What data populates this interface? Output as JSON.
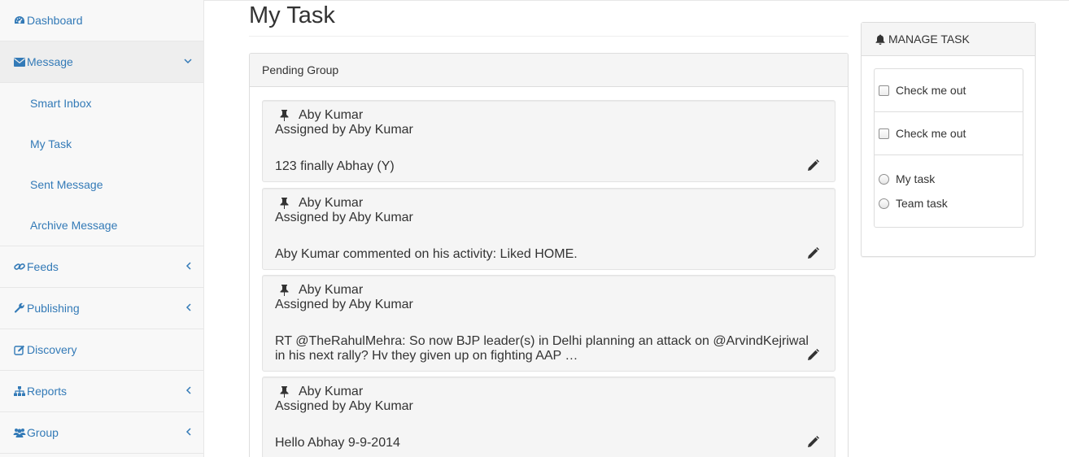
{
  "sidebar": {
    "dashboard": {
      "label": "Dashboard",
      "icon": "dashboard-icon"
    },
    "message": {
      "label": "Message",
      "icon": "envelope-icon"
    },
    "message_sub": [
      "Smart Inbox",
      "My Task",
      "Sent Message",
      "Archive Message"
    ],
    "feeds": {
      "label": "Feeds",
      "icon": "link-icon"
    },
    "publishing": {
      "label": "Publishing",
      "icon": "wrench-icon"
    },
    "discovery": {
      "label": "Discovery",
      "icon": "edit-icon"
    },
    "reports": {
      "label": "Reports",
      "icon": "sitemap-icon"
    },
    "group": {
      "label": "Group",
      "icon": "users-icon"
    }
  },
  "main": {
    "title": "My Task",
    "panel_heading": "Pending Group",
    "tasks": [
      {
        "name": "Aby Kumar",
        "assigned": "Assigned by Aby Kumar",
        "text": "123 finally Abhay (Y)"
      },
      {
        "name": "Aby Kumar",
        "assigned": "Assigned by Aby Kumar",
        "text": "Aby Kumar commented on his activity: Liked HOME."
      },
      {
        "name": "Aby Kumar",
        "assigned": "Assigned by Aby Kumar",
        "text": "RT @TheRahulMehra: So now BJP leader(s) in Delhi planning an attack on @ArvindKejriwal in his next rally? Hv they given up on fighting AAP …"
      },
      {
        "name": "Aby Kumar",
        "assigned": "Assigned by Aby Kumar",
        "text": "Hello Abhay 9-9-2014"
      }
    ]
  },
  "manage": {
    "heading": "MANAGE TASK",
    "checkbox_1": "Check me out",
    "checkbox_2": "Check me out",
    "radio_1": "My task",
    "radio_2": "Team task"
  },
  "colors": {
    "link": "#337ab7",
    "sidebar_bg": "#f8f8f8",
    "card_bg": "#f5f5f5"
  }
}
